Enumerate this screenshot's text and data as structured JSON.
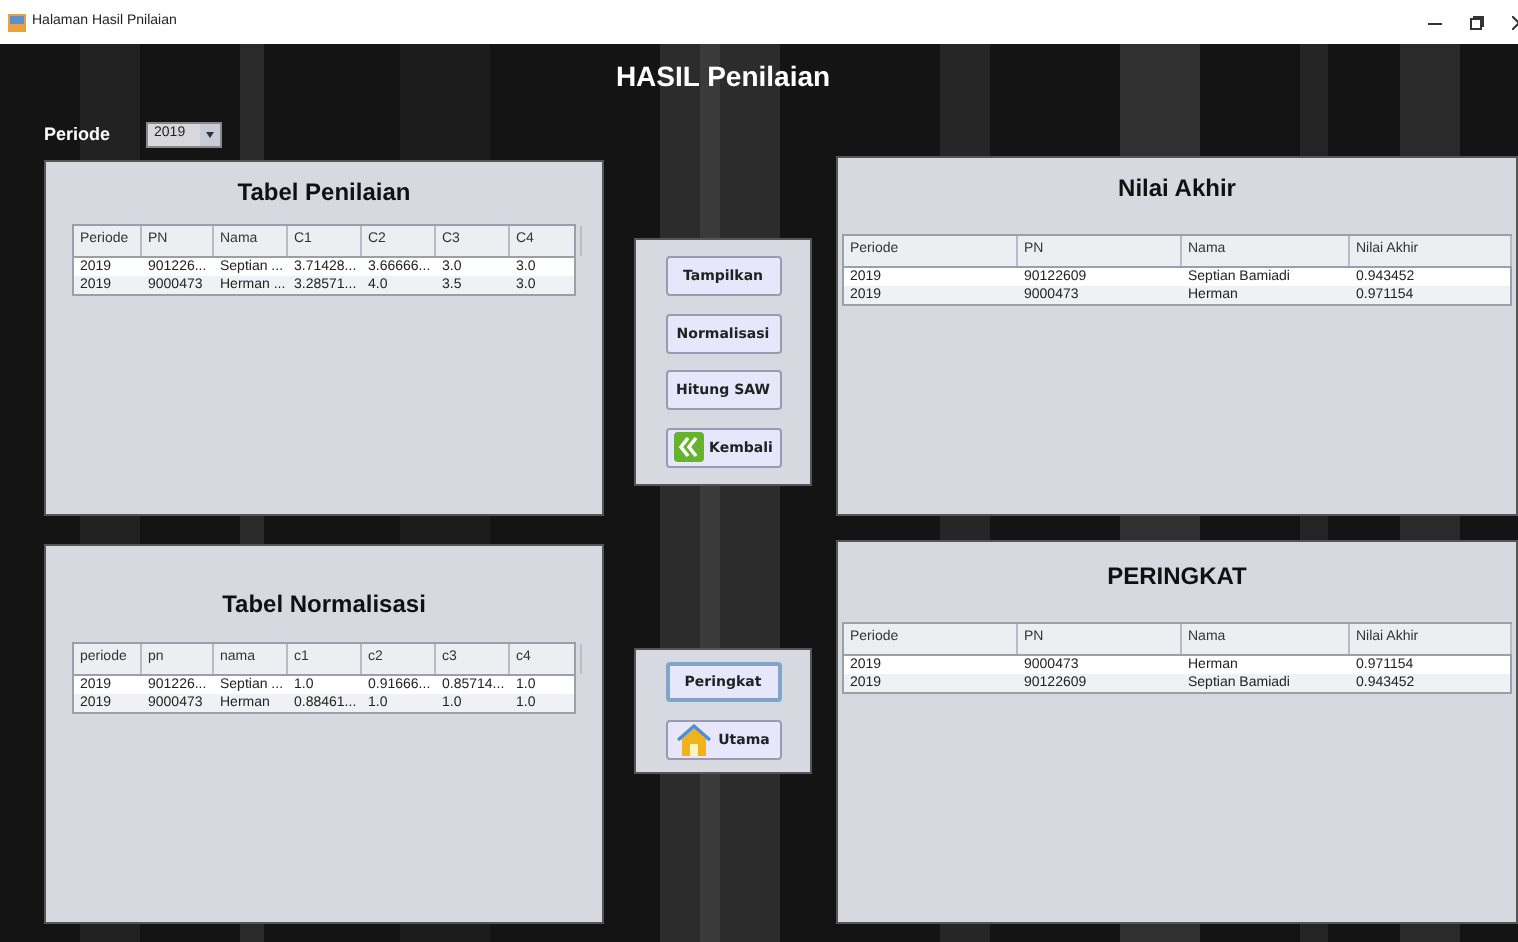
{
  "window": {
    "title": "Halaman Hasil Pnilaian"
  },
  "heading": "HASIL Penilaian",
  "periode": {
    "label": "Periode",
    "value": "2019"
  },
  "tabel_penilaian": {
    "title": "Tabel Penilaian",
    "columns": [
      "Periode",
      "PN",
      "Nama",
      "C1",
      "C2",
      "C3",
      "C4"
    ],
    "rows": [
      [
        "2019",
        "901226...",
        "Septian ...",
        "3.71428...",
        "3.66666...",
        "3.0",
        "3.0"
      ],
      [
        "2019",
        "9000473",
        "Herman ...",
        "3.28571...",
        "4.0",
        "3.5",
        "3.0"
      ]
    ]
  },
  "tabel_normalisasi": {
    "title": "Tabel Normalisasi",
    "columns": [
      "periode",
      "pn",
      "nama",
      "c1",
      "c2",
      "c3",
      "c4"
    ],
    "rows": [
      [
        "2019",
        "901226...",
        "Septian ...",
        "1.0",
        "0.91666...",
        "0.85714...",
        "1.0"
      ],
      [
        "2019",
        "9000473",
        "Herman",
        "0.88461...",
        "1.0",
        "1.0",
        "1.0"
      ]
    ]
  },
  "actions_top": [
    {
      "label": "Tampilkan",
      "kind": "plain",
      "focused": false
    },
    {
      "label": "Normalisasi",
      "kind": "plain",
      "focused": false
    },
    {
      "label": "Hitung SAW",
      "kind": "plain",
      "focused": false
    },
    {
      "label": "Kembali",
      "kind": "back",
      "focused": false
    }
  ],
  "actions_bottom": [
    {
      "label": "Peringkat",
      "kind": "plain",
      "focused": true
    },
    {
      "label": "Utama",
      "kind": "home",
      "focused": false
    }
  ],
  "nilai_akhir": {
    "title": "Nilai Akhir",
    "columns": [
      "Periode",
      "PN",
      "Nama",
      "Nilai Akhir"
    ],
    "rows": [
      [
        "2019",
        "90122609",
        "Septian Bamiadi",
        "0.943452"
      ],
      [
        "2019",
        "9000473",
        "Herman",
        "0.971154"
      ]
    ]
  },
  "peringkat": {
    "title": "PERINGKAT",
    "columns": [
      "Periode",
      "PN",
      "Nama",
      "Nilai Akhir"
    ],
    "rows": [
      [
        "2019",
        "9000473",
        "Herman",
        "0.971154"
      ],
      [
        "2019",
        "90122609",
        "Septian Bamiadi",
        "0.943452"
      ]
    ]
  }
}
